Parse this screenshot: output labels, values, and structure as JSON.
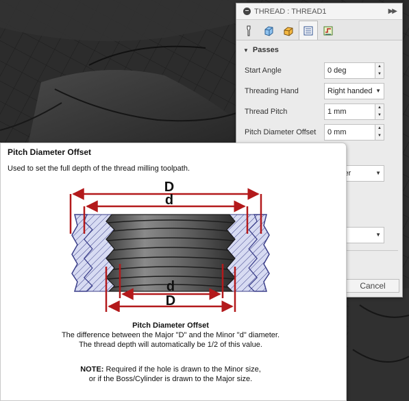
{
  "panel": {
    "title": "THREAD : THREAD1",
    "tabs": [
      "tool-icon",
      "shape-icon",
      "geometry-icon",
      "passes-icon",
      "linking-icon"
    ],
    "section": "Passes",
    "fields": [
      {
        "label": "Start Angle",
        "value": "0 deg",
        "kind": "spin"
      },
      {
        "label": "Threading Hand",
        "value": "Right handed",
        "kind": "select"
      },
      {
        "label": "Thread Pitch",
        "value": "1 mm",
        "kind": "spin"
      },
      {
        "label": "Pitch Diameter Offset",
        "value": "0 mm",
        "kind": "spin"
      }
    ],
    "hidden_select_fragment": "mputer",
    "cancel_label": "Cancel"
  },
  "tooltip": {
    "title": "Pitch Diameter Offset",
    "description": "Used to set the full depth of the thread milling toolpath.",
    "diagram_labels": {
      "major_top": "D",
      "minor_top": "d",
      "minor_bottom": "d",
      "major_bottom": "D"
    },
    "caption_title": "Pitch Diameter Offset",
    "caption_line1": "The difference between the Major \"D\" and the Minor \"d\" diameter.",
    "caption_line2": "The thread depth will automatically be 1/2 of this value.",
    "note_label": "NOTE:",
    "note_line1": " Required if the hole is drawn to the Minor size,",
    "note_line2": "or if the Boss/Cylinder is drawn to the Major size."
  },
  "colors": {
    "dimension_red": "#b3191b",
    "hatch_fill": "#d7dbf2",
    "hatch_stroke": "#3b3f8a"
  }
}
